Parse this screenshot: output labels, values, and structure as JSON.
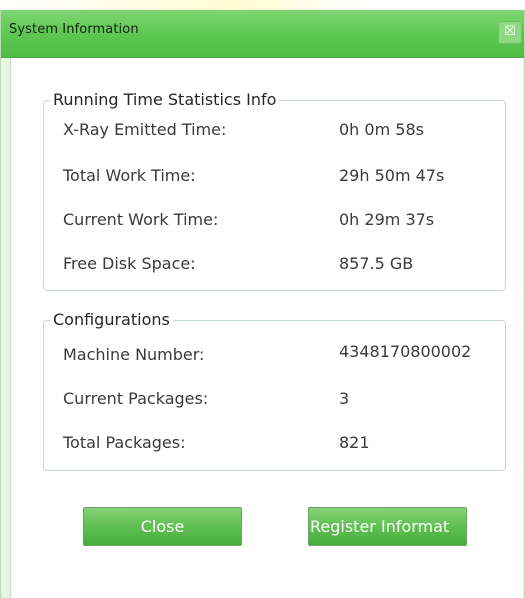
{
  "window": {
    "title": "System Information",
    "close_glyph": "☒"
  },
  "running_time": {
    "legend": "Running Time Statistics Info",
    "rows": [
      {
        "label": "X-Ray Emitted Time:",
        "value": "0h 0m 58s"
      },
      {
        "label": "Total Work Time:",
        "value": "29h 50m 47s"
      },
      {
        "label": "Current Work Time:",
        "value": "0h 29m 37s"
      },
      {
        "label": "Free Disk Space:",
        "value": "857.5 GB"
      }
    ]
  },
  "configurations": {
    "legend": "Configurations",
    "rows": [
      {
        "label": "Machine Number:",
        "value": "4348170800002"
      },
      {
        "label": "Current Packages:",
        "value": "3"
      },
      {
        "label": "Total Packages:",
        "value": "821"
      }
    ]
  },
  "buttons": {
    "close_label": "Close",
    "register_label": "Register Informat"
  },
  "colors": {
    "title_bar": "#5cc650",
    "button": "#5cbe4f",
    "group_border": "#c8d4e6"
  },
  "icons": {
    "close": "close-icon"
  }
}
